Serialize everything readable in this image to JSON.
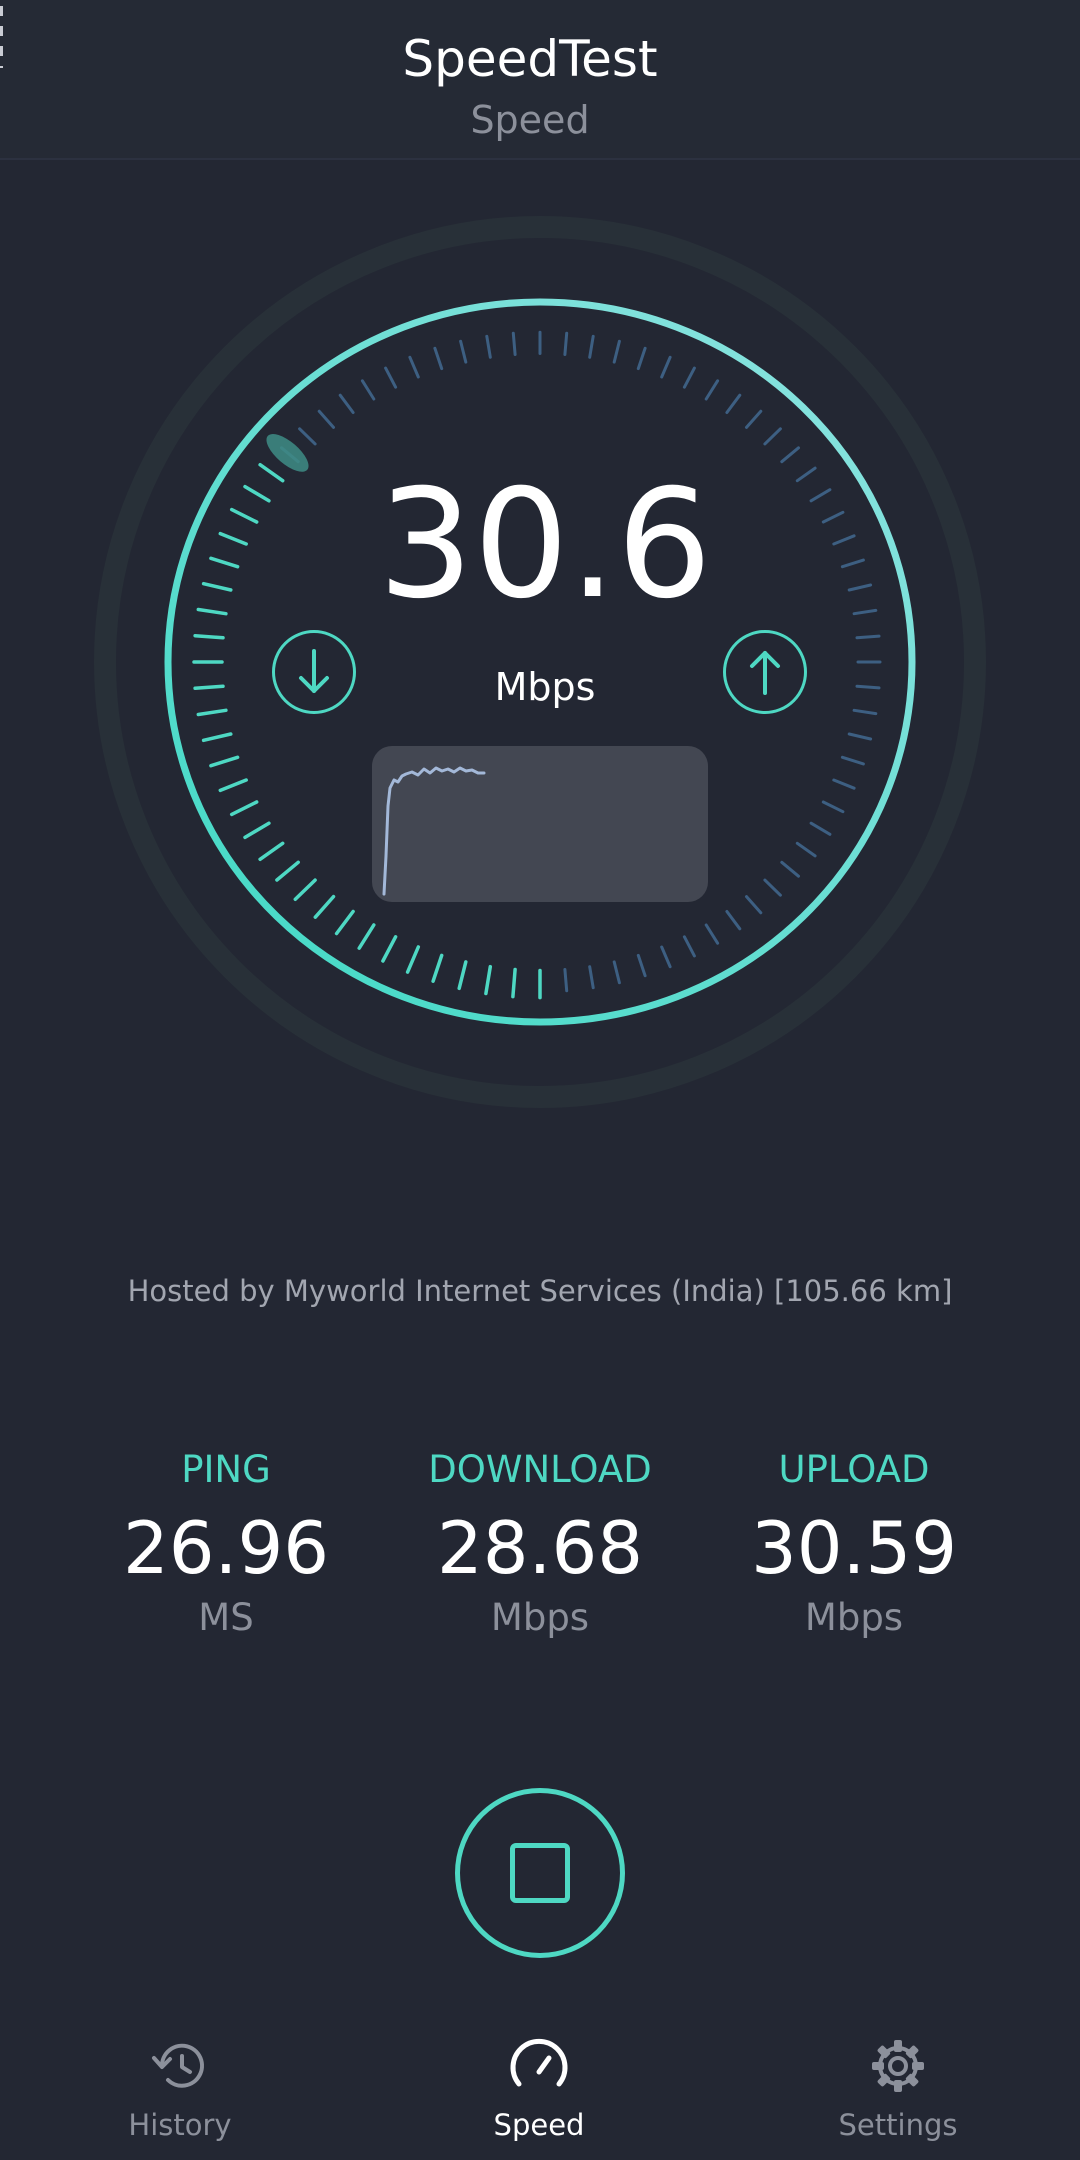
{
  "header": {
    "title": "SpeedTest",
    "subtitle": "Speed"
  },
  "gauge": {
    "current_speed": "30.6",
    "unit": "Mbps",
    "progress": 0.36,
    "download_icon": "arrow-down-icon",
    "upload_icon": "arrow-up-icon"
  },
  "server": {
    "info": "Hosted by Myworld Internet Services (India) [105.66 km]"
  },
  "stats": {
    "ping": {
      "label": "PING",
      "value": "26.96",
      "unit": "MS"
    },
    "download": {
      "label": "DOWNLOAD",
      "value": "28.68",
      "unit": "Mbps"
    },
    "upload": {
      "label": "UPLOAD",
      "value": "30.59",
      "unit": "Mbps"
    }
  },
  "control": {
    "icon": "stop-icon"
  },
  "nav": {
    "items": [
      {
        "label": "History",
        "icon": "history-icon",
        "active": false
      },
      {
        "label": "Speed",
        "icon": "speedometer-icon",
        "active": true
      },
      {
        "label": "Settings",
        "icon": "gear-icon",
        "active": false
      }
    ]
  },
  "colors": {
    "accent": "#4ed8c3",
    "background": "#232733",
    "tick_inactive": "#3d5f82",
    "muted_text": "#8c909b"
  }
}
